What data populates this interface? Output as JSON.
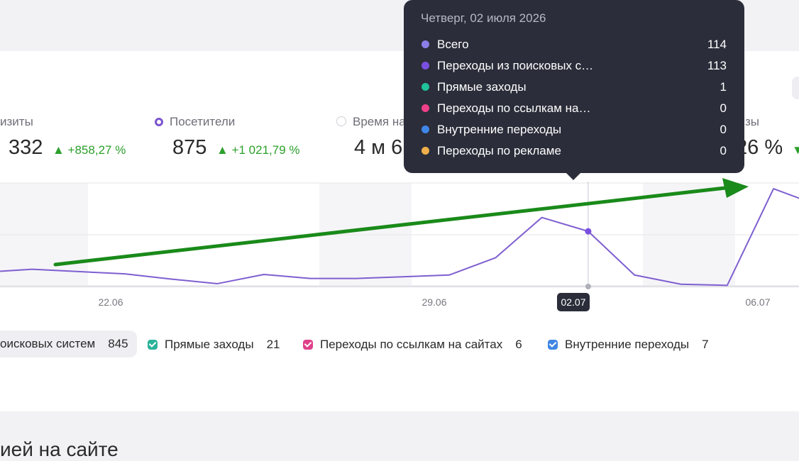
{
  "metrics": [
    {
      "label": "изиты",
      "value": "332",
      "delta": "▲ +858,27 %",
      "selected": false
    },
    {
      "label": "Посетители",
      "value": "875",
      "delta": "▲ +1 021,79 %",
      "selected": true
    },
    {
      "label": "Время на",
      "value": "4 м 6",
      "delta": "",
      "selected": false
    },
    {
      "label": "зы",
      "value": "26 %",
      "delta": "▼",
      "selected": false
    }
  ],
  "chart_data": {
    "type": "line",
    "x_ticks": [
      "22.06",
      "29.06",
      "02.07",
      "06.07"
    ],
    "highlighted_tick": "02.07",
    "series": [
      {
        "name": "Переходы из поисковых систем",
        "color": "#7e5fd0",
        "values": [
          2.5,
          3.0,
          2.6,
          2.2,
          1.3,
          0.5,
          2.1,
          1.4,
          1.4,
          1.7,
          2.0,
          5.0,
          12.0,
          9.6,
          2.0,
          0.4,
          0.2,
          17.0,
          14.0
        ]
      }
    ],
    "ylim": [
      0,
      18
    ],
    "grid": true,
    "annotation": "green upward trend arrow"
  },
  "legend": [
    {
      "label": "оисковых систем",
      "count": "845",
      "color": "#7e5fd0"
    },
    {
      "label": "Прямые заходы",
      "count": "21",
      "color": "#2bb39a"
    },
    {
      "label": "Переходы по ссылкам на сайтах",
      "count": "6",
      "color": "#e0408a"
    },
    {
      "label": "Внутренние переходы",
      "count": "7",
      "color": "#3f86e3"
    }
  ],
  "tooltip": {
    "date": "Четверг, 02 июля 2026",
    "rows": [
      {
        "label": "Всего",
        "value": "114",
        "color": "#8c7ee8"
      },
      {
        "label": "Переходы из поисковых с…",
        "value": "113",
        "color": "#7a4fe0"
      },
      {
        "label": "Прямые заходы",
        "value": "1",
        "color": "#1fc29a"
      },
      {
        "label": "Переходы по ссылкам на…",
        "value": "0",
        "color": "#f0408a"
      },
      {
        "label": "Внутренние переходы",
        "value": "0",
        "color": "#3f86e8"
      },
      {
        "label": "Переходы по рекламе",
        "value": "0",
        "color": "#f0b04a"
      }
    ]
  },
  "section_title": "ией на сайте"
}
